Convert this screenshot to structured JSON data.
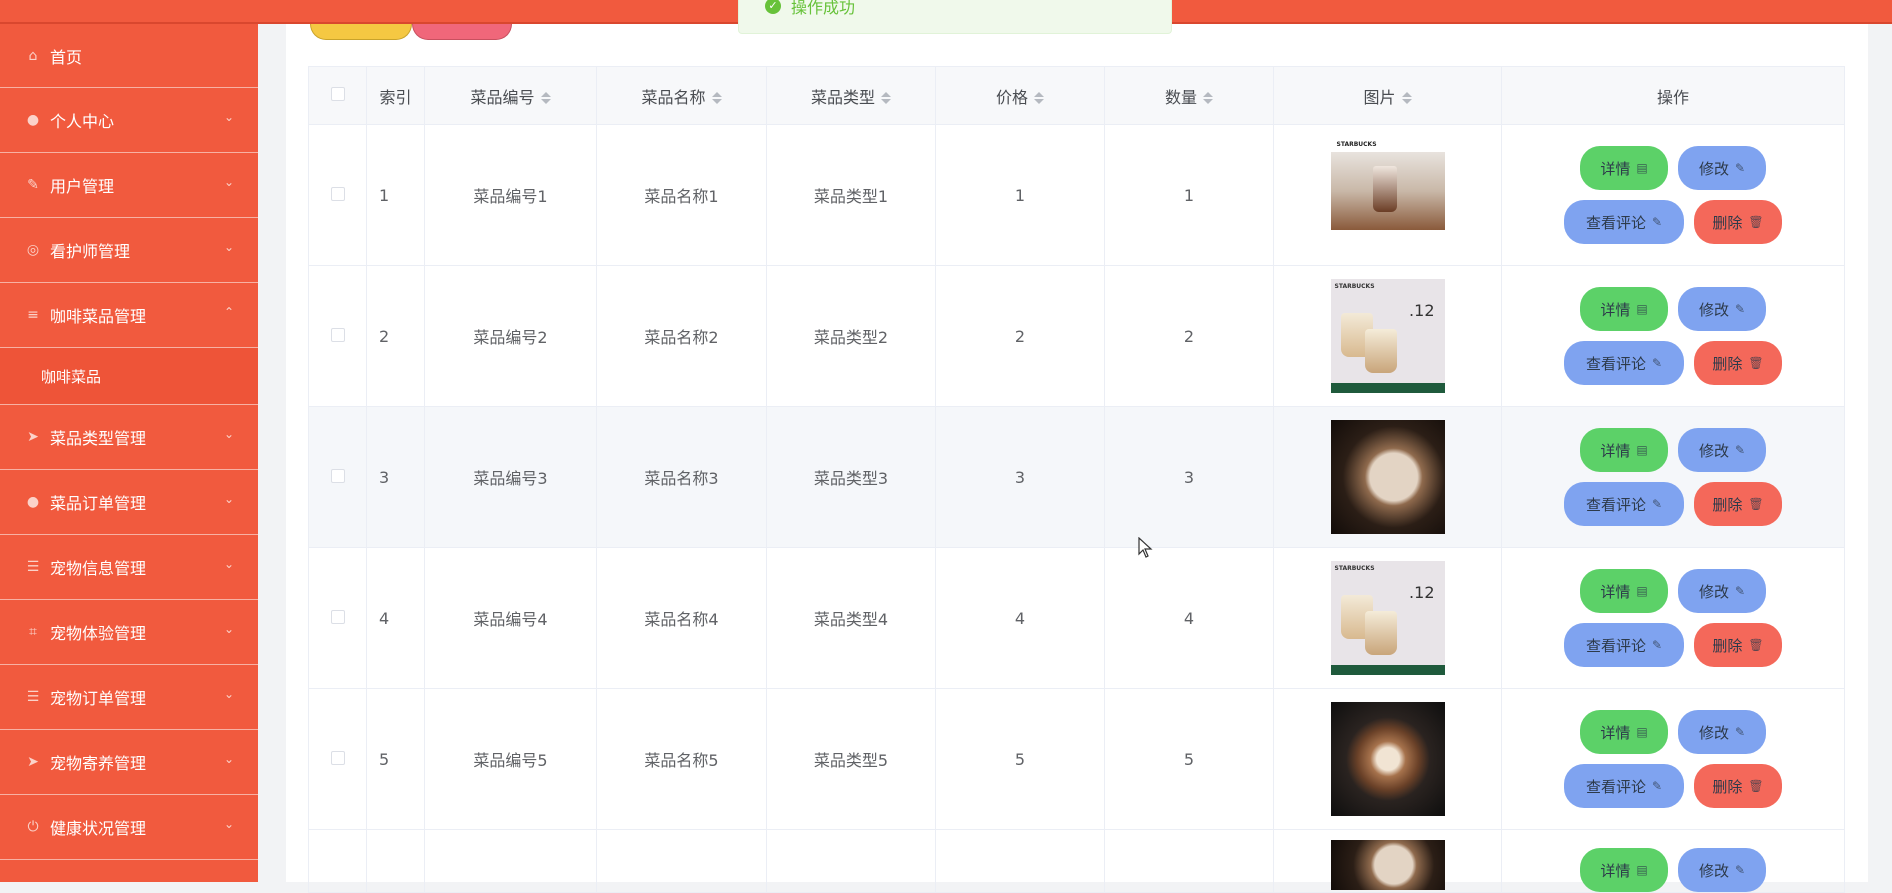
{
  "toast": {
    "message": "操作成功"
  },
  "sidebar": {
    "items": [
      {
        "label": "首页",
        "icon": "home-icon",
        "expanded": false
      },
      {
        "label": "个人中心",
        "icon": "user-icon",
        "expanded": false
      },
      {
        "label": "用户管理",
        "icon": "edit-icon",
        "expanded": false
      },
      {
        "label": "看护师管理",
        "icon": "compass-icon",
        "expanded": false
      },
      {
        "label": "咖啡菜品管理",
        "icon": "menu-icon",
        "expanded": true
      },
      {
        "label": "菜品类型管理",
        "icon": "send-icon",
        "expanded": false
      },
      {
        "label": "菜品订单管理",
        "icon": "user-icon",
        "expanded": false
      },
      {
        "label": "宠物信息管理",
        "icon": "sliders-icon",
        "expanded": false
      },
      {
        "label": "宠物体验管理",
        "icon": "crop-icon",
        "expanded": false
      },
      {
        "label": "宠物订单管理",
        "icon": "sliders-icon",
        "expanded": false
      },
      {
        "label": "宠物寄养管理",
        "icon": "send-icon",
        "expanded": false
      },
      {
        "label": "健康状况管理",
        "icon": "power-icon",
        "expanded": false
      }
    ],
    "submenu": {
      "label": "咖啡菜品"
    }
  },
  "table": {
    "headers": {
      "index": "索引",
      "code": "菜品编号",
      "name": "菜品名称",
      "type": "菜品类型",
      "price": "价格",
      "qty": "数量",
      "image": "图片",
      "ops": "操作"
    },
    "rows": [
      {
        "index": "1",
        "code": "菜品编号1",
        "name": "菜品名称1",
        "type": "菜品类型1",
        "price": "1",
        "qty": "1"
      },
      {
        "index": "2",
        "code": "菜品编号2",
        "name": "菜品名称2",
        "type": "菜品类型2",
        "price": "2",
        "qty": "2"
      },
      {
        "index": "3",
        "code": "菜品编号3",
        "name": "菜品名称3",
        "type": "菜品类型3",
        "price": "3",
        "qty": "3"
      },
      {
        "index": "4",
        "code": "菜品编号4",
        "name": "菜品名称4",
        "type": "菜品类型4",
        "price": "4",
        "qty": "4"
      },
      {
        "index": "5",
        "code": "菜品编号5",
        "name": "菜品名称5",
        "type": "菜品类型5",
        "price": "5",
        "qty": "5"
      }
    ],
    "thumb_text": {
      "brand": "STARBUCKS",
      "number": ".12"
    }
  },
  "actions": {
    "detail": "详情",
    "edit": "修改",
    "review": "查看评论",
    "delete": "删除"
  },
  "colors": {
    "sidebar": "#f15a3e",
    "detail_button": "#5cd168",
    "edit_button": "#7fa3f0",
    "delete_button": "#f4685a",
    "toast_text": "#67c23a"
  }
}
